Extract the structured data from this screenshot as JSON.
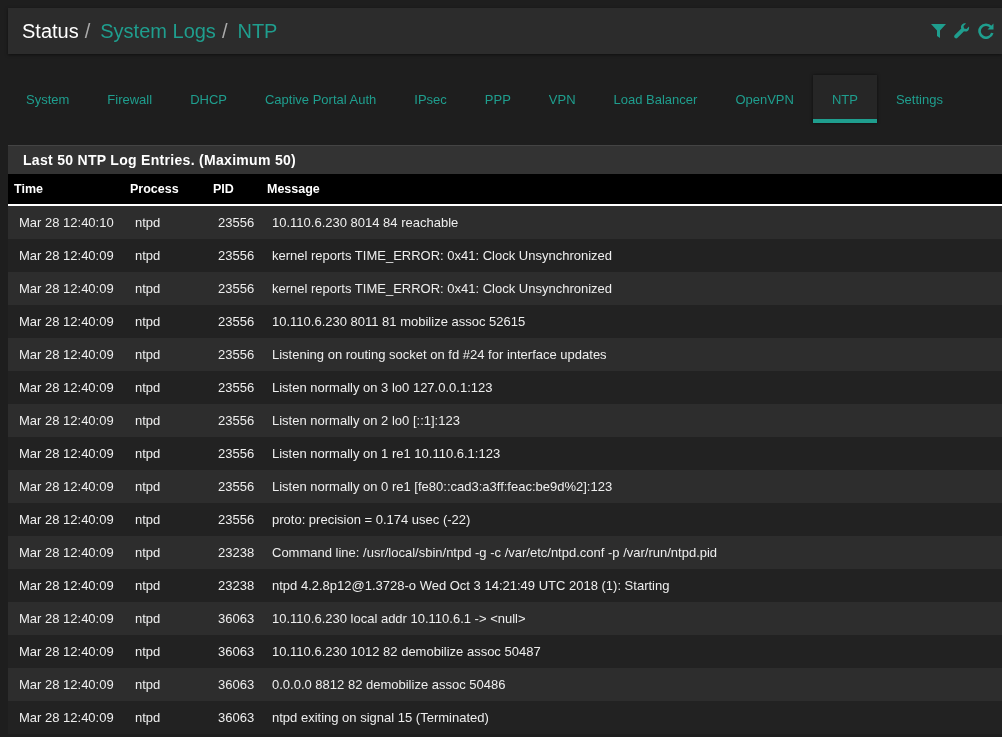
{
  "breadcrumb_separator": "/",
  "breadcrumb": [
    {
      "label": "Status",
      "link": false
    },
    {
      "label": "System Logs",
      "link": true
    },
    {
      "label": "NTP",
      "link": true
    }
  ],
  "tabs": [
    {
      "label": "System",
      "selected": false
    },
    {
      "label": "Firewall",
      "selected": false
    },
    {
      "label": "DHCP",
      "selected": false
    },
    {
      "label": "Captive Portal Auth",
      "selected": false
    },
    {
      "label": "IPsec",
      "selected": false
    },
    {
      "label": "PPP",
      "selected": false
    },
    {
      "label": "VPN",
      "selected": false
    },
    {
      "label": "Load Balancer",
      "selected": false
    },
    {
      "label": "OpenVPN",
      "selected": false
    },
    {
      "label": "NTP",
      "selected": true
    },
    {
      "label": "Settings",
      "selected": false
    }
  ],
  "panel": {
    "title": "Last 50 NTP Log Entries. (Maximum 50)",
    "columns": [
      "Time",
      "Process",
      "PID",
      "Message"
    ],
    "rows": [
      [
        "Mar 28 12:40:10",
        "ntpd",
        "23556",
        "10.110.6.230 8014 84 reachable"
      ],
      [
        "Mar 28 12:40:09",
        "ntpd",
        "23556",
        "kernel reports TIME_ERROR: 0x41: Clock Unsynchronized"
      ],
      [
        "Mar 28 12:40:09",
        "ntpd",
        "23556",
        "kernel reports TIME_ERROR: 0x41: Clock Unsynchronized"
      ],
      [
        "Mar 28 12:40:09",
        "ntpd",
        "23556",
        "10.110.6.230 8011 81 mobilize assoc 52615"
      ],
      [
        "Mar 28 12:40:09",
        "ntpd",
        "23556",
        "Listening on routing socket on fd #24 for interface updates"
      ],
      [
        "Mar 28 12:40:09",
        "ntpd",
        "23556",
        "Listen normally on 3 lo0 127.0.0.1:123"
      ],
      [
        "Mar 28 12:40:09",
        "ntpd",
        "23556",
        "Listen normally on 2 lo0 [::1]:123"
      ],
      [
        "Mar 28 12:40:09",
        "ntpd",
        "23556",
        "Listen normally on 1 re1 10.110.6.1:123"
      ],
      [
        "Mar 28 12:40:09",
        "ntpd",
        "23556",
        "Listen normally on 0 re1 [fe80::cad3:a3ff:feac:be9d%2]:123"
      ],
      [
        "Mar 28 12:40:09",
        "ntpd",
        "23556",
        "proto: precision = 0.174 usec (-22)"
      ],
      [
        "Mar 28 12:40:09",
        "ntpd",
        "23238",
        "Command line: /usr/local/sbin/ntpd -g -c /var/etc/ntpd.conf -p /var/run/ntpd.pid"
      ],
      [
        "Mar 28 12:40:09",
        "ntpd",
        "23238",
        "ntpd 4.2.8p12@1.3728-o Wed Oct 3 14:21:49 UTC 2018 (1): Starting"
      ],
      [
        "Mar 28 12:40:09",
        "ntpd",
        "36063",
        "10.110.6.230 local addr 10.110.6.1 -> <null>"
      ],
      [
        "Mar 28 12:40:09",
        "ntpd",
        "36063",
        "10.110.6.230 1012 82 demobilize assoc 50487"
      ],
      [
        "Mar 28 12:40:09",
        "ntpd",
        "36063",
        "0.0.0.0 8812 82 demobilize assoc 50486"
      ],
      [
        "Mar 28 12:40:09",
        "ntpd",
        "36063",
        "ntpd exiting on signal 15 (Terminated)"
      ]
    ]
  }
}
